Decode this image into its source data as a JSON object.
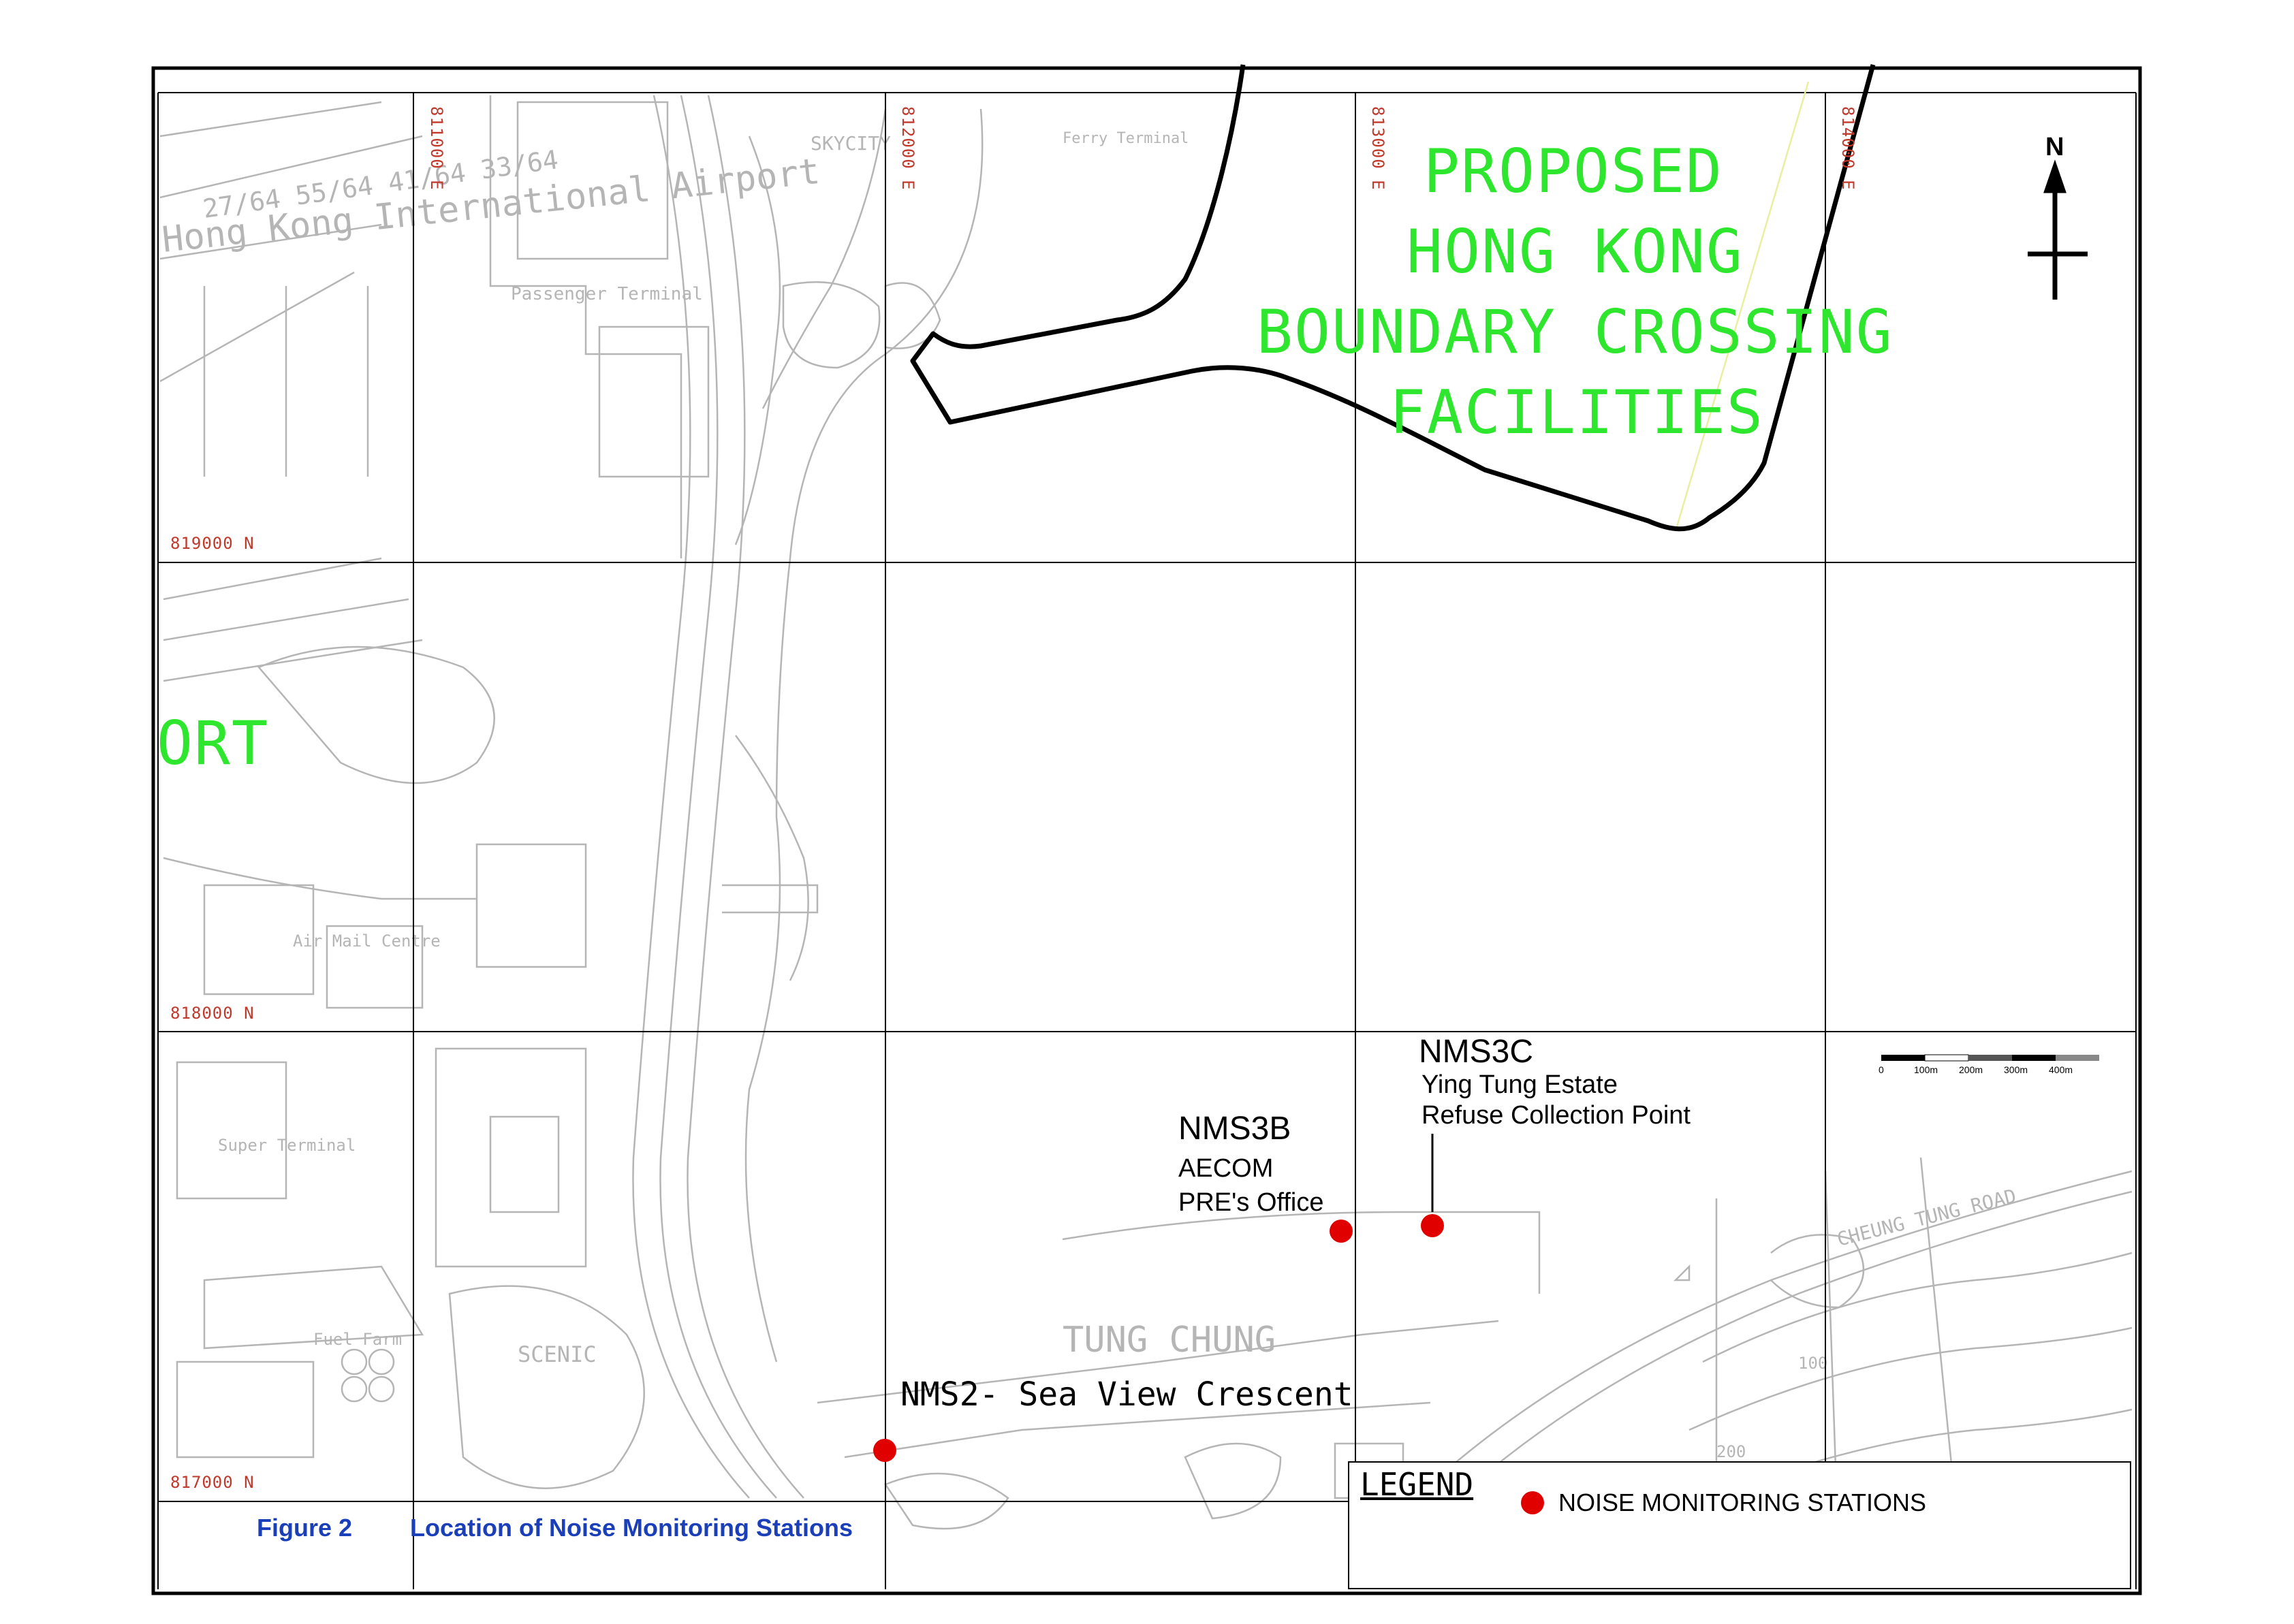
{
  "map": {
    "grid_labels": {
      "eastings": [
        "811000 E",
        "812000 E",
        "813000 E",
        "814000 E"
      ],
      "northings": [
        "819000 N",
        "818000 N",
        "817000 N"
      ]
    },
    "airport_fragment": "ORT",
    "area_title_lines": [
      "PROPOSED",
      "HONG KONG",
      "BOUNDARY CROSSING",
      "FACILITIES"
    ],
    "north_label": "N",
    "scale_labels": [
      "0",
      "100m",
      "200m",
      "300m",
      "400m"
    ],
    "colors": {
      "station_marker": "#e00000",
      "boundary_line": "#000000",
      "area_title": "#2ee62e",
      "grid_label": "#c0392b",
      "caption": "#1a3fb8",
      "basemap_line": "#b5b5b5"
    },
    "basemap_place_labels": [
      "TUNG CHUNG",
      "SCENIC",
      "Passenger Terminal",
      "SKYCITY",
      "Ferry Terminal",
      "Air Mail Centre",
      "Super Terminal",
      "Fuel Farm",
      "CHEUNG TUNG ROAD",
      "100",
      "200",
      "27/64 55/64 41/64 33/64",
      "Hong Kong International Airport"
    ]
  },
  "stations": [
    {
      "code": "NMS3C",
      "desc_lines": [
        "Ying Tung Estate",
        "Refuse Collection Point"
      ]
    },
    {
      "code": "NMS3B",
      "desc_lines": [
        "AECOM",
        "PRE's Office"
      ]
    },
    {
      "label": "NMS2- Sea View Crescent"
    }
  ],
  "caption": {
    "figure": "Figure 2",
    "title": "Location of Noise Monitoring Stations"
  },
  "legend": {
    "title": "LEGEND",
    "items": [
      {
        "label": "NOISE MONITORING STATIONS",
        "icon": "red-dot-icon"
      }
    ]
  }
}
